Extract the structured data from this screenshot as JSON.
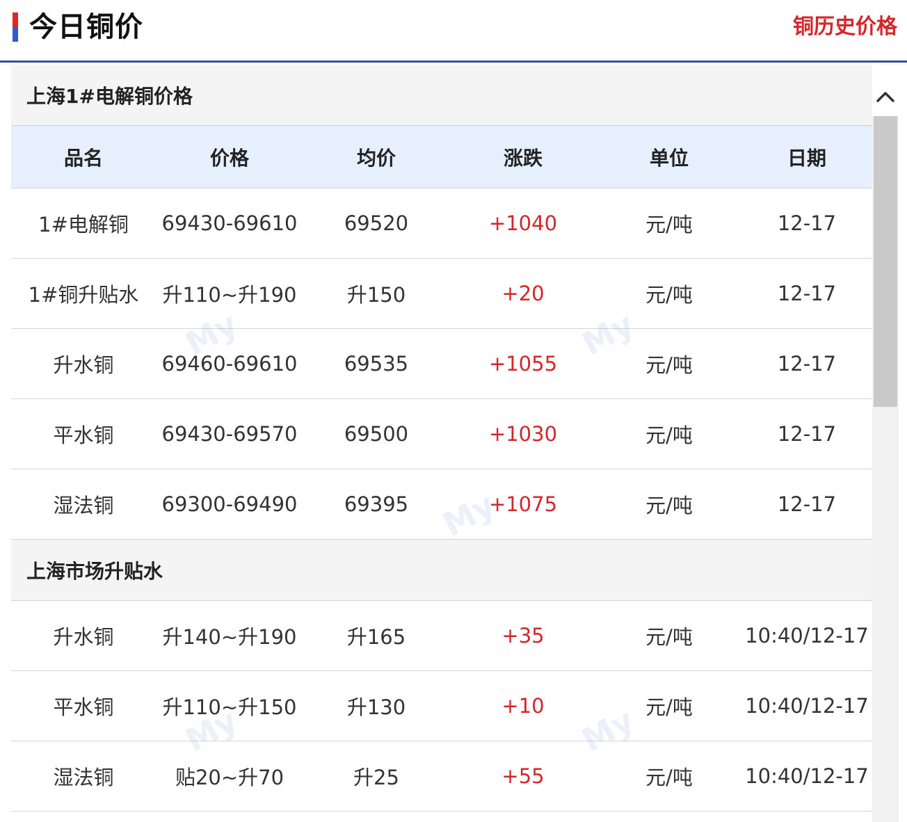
{
  "header": {
    "title": "今日铜价",
    "history_link": "铜历史价格"
  },
  "sections": [
    {
      "title": "上海1#电解铜价格",
      "columns": [
        "品名",
        "价格",
        "均价",
        "涨跌",
        "单位",
        "日期"
      ],
      "rows": [
        {
          "name": "1#电解铜",
          "price": "69430-69610",
          "avg": "69520",
          "change": "+1040",
          "unit": "元/吨",
          "date": "12-17"
        },
        {
          "name": "1#铜升贴水",
          "price": "升110~升190",
          "avg": "升150",
          "change": "+20",
          "unit": "元/吨",
          "date": "12-17"
        },
        {
          "name": "升水铜",
          "price": "69460-69610",
          "avg": "69535",
          "change": "+1055",
          "unit": "元/吨",
          "date": "12-17"
        },
        {
          "name": "平水铜",
          "price": "69430-69570",
          "avg": "69500",
          "change": "+1030",
          "unit": "元/吨",
          "date": "12-17"
        },
        {
          "name": "湿法铜",
          "price": "69300-69490",
          "avg": "69395",
          "change": "+1075",
          "unit": "元/吨",
          "date": "12-17"
        }
      ]
    },
    {
      "title": "上海市场升贴水",
      "rows": [
        {
          "name": "升水铜",
          "price": "升140~升190",
          "avg": "升165",
          "change": "+35",
          "unit": "元/吨",
          "date": "10:40/12-17"
        },
        {
          "name": "平水铜",
          "price": "升110~升150",
          "avg": "升130",
          "change": "+10",
          "unit": "元/吨",
          "date": "10:40/12-17"
        },
        {
          "name": "湿法铜",
          "price": "贴20~升70",
          "avg": "升25",
          "change": "+55",
          "unit": "元/吨",
          "date": "10:40/12-17"
        }
      ]
    }
  ],
  "watermark": "My",
  "colors": {
    "accent_blue": "#2f4f9a",
    "accent_red": "#d5262b",
    "header_row_bg": "#e6f0fc",
    "section_bg": "#f4f4f4"
  },
  "icons": {
    "collapse": "chevron-up-icon"
  }
}
